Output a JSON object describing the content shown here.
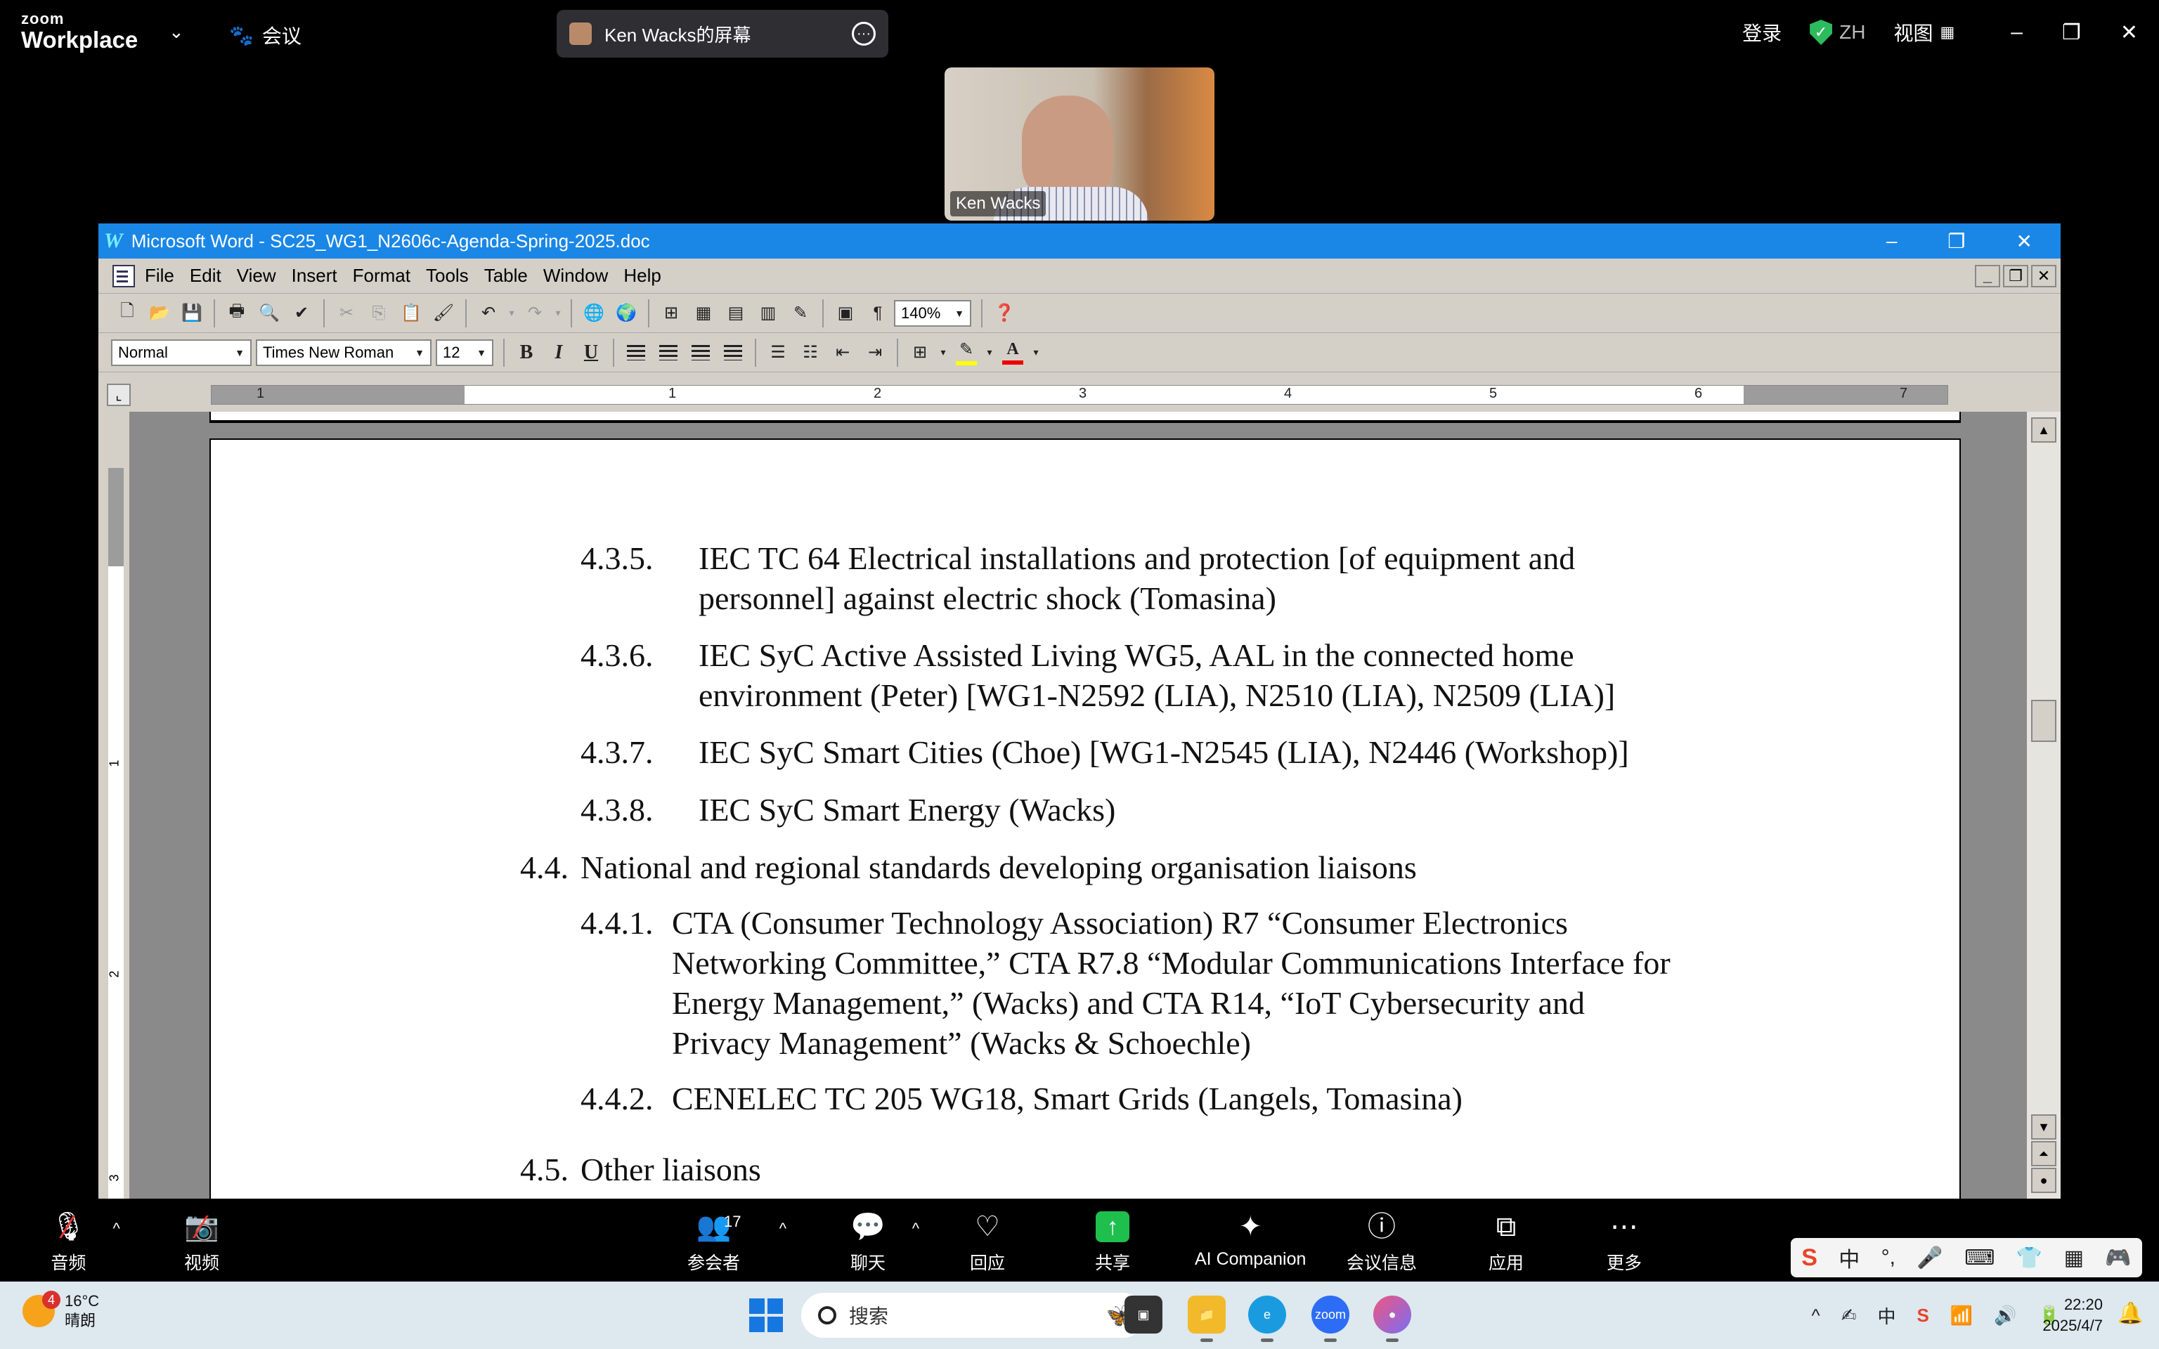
{
  "zoom": {
    "logo_line1": "zoom",
    "logo_line2": "Workplace",
    "meeting_label": "会议",
    "share_label": "Ken Wacks的屏幕",
    "login": "登录",
    "lang": "ZH",
    "view": "视图",
    "video_name": "Ken Wacks",
    "bottom": {
      "audio": "音频",
      "video": "视频",
      "participants": "参会者",
      "participants_count": "17",
      "chat": "聊天",
      "react": "回应",
      "share": "共享",
      "ai": "AI Companion",
      "info": "会议信息",
      "apps": "应用",
      "more": "更多"
    }
  },
  "word": {
    "title": "Microsoft Word - SC25_WG1_N2606c-Agenda-Spring-2025.doc",
    "menu": [
      "File",
      "Edit",
      "View",
      "Insert",
      "Format",
      "Tools",
      "Table",
      "Window",
      "Help"
    ],
    "zoom_level": "140%",
    "style": "Normal",
    "font": "Times New Roman",
    "size": "12",
    "ruler_numbers": [
      "1",
      "1",
      "2",
      "3",
      "4",
      "5",
      "6",
      "7"
    ],
    "vruler_numbers": [
      "1",
      "2",
      "3"
    ]
  },
  "document": {
    "paragraphs": [
      {
        "num": "4.3.5.",
        "lines": [
          "IEC TC 64 Electrical installations and protection [of equipment and",
          "personnel] against electric shock (Tomasina)"
        ]
      },
      {
        "num": "4.3.6.",
        "lines": [
          "IEC SyC Active Assisted Living WG5, AAL in the connected home",
          "environment (Peter) [WG1-N2592 (LIA), N2510 (LIA), N2509 (LIA)]"
        ]
      },
      {
        "num": "4.3.7.",
        "lines": [
          "IEC SyC Smart Cities (Choe) [WG1-N2545 (LIA), N2446 (Workshop)]"
        ]
      },
      {
        "num": "4.3.8.",
        "lines": [
          "IEC SyC Smart Energy (Wacks)"
        ]
      },
      {
        "num": "4.4.",
        "lines": [
          "National and regional standards developing organisation liaisons"
        ]
      },
      {
        "num": "4.4.1.",
        "lines": [
          "CTA (Consumer Technology Association) R7 “Consumer Electronics",
          "Networking Committee,” CTA R7.8 “Modular Communications Interface for",
          "Energy Management,” (Wacks) and CTA R14, “IoT Cybersecurity and",
          "Privacy Management” (Wacks & Schoechle)"
        ]
      },
      {
        "num": "4.4.2.",
        "lines": [
          "CENELEC TC 205 WG18, Smart Grids (Langels, Tomasina)"
        ]
      },
      {
        "num": "4.5.",
        "lines": [
          "Other liaisons"
        ]
      }
    ]
  },
  "taskbar": {
    "temp": "16°C",
    "weather": "晴朗",
    "badge": "4",
    "search": "搜索",
    "time": "22:20",
    "date": "2025/4/7"
  },
  "ime": {
    "lang": "中"
  }
}
